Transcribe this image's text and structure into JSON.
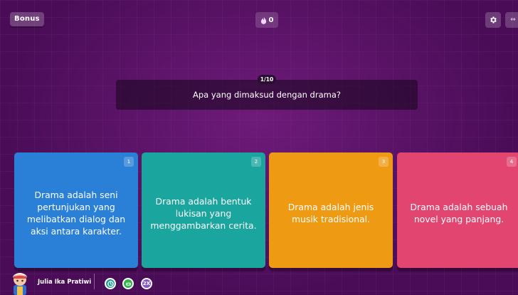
{
  "header": {
    "bonus_label": "Bonus",
    "streak_count": "0",
    "settings_icon": "gear-icon",
    "expand_icon": "expand-arrows-icon"
  },
  "question": {
    "counter": "1/10",
    "text": "Apa yang dimaksud dengan drama?"
  },
  "options": [
    {
      "number": "1",
      "label": "Drama adalah seni pertunjukan yang melibatkan dialog dan aksi antara karakter.",
      "color": "#2a80d6"
    },
    {
      "number": "2",
      "label": "Drama adalah bentuk lukisan yang menggambarkan cerita.",
      "color": "#1aa59e"
    },
    {
      "number": "3",
      "label": "Drama adalah jenis musik tradisional.",
      "color": "#ef9a13"
    },
    {
      "number": "4",
      "label": "Drama adalah sebuah novel yang panjang.",
      "color": "#e2456f"
    }
  ],
  "player": {
    "name": "Julia Ika Pratiwi",
    "avatar_icon": "avatar-icon"
  },
  "powerups": [
    {
      "icon": "timer-powerup-icon",
      "color": "#1e9d95"
    },
    {
      "icon": "powerup-icon",
      "color": "#2fb64a"
    },
    {
      "icon": "2x-powerup-icon",
      "label": "2X",
      "color": "#8a54c9"
    }
  ]
}
